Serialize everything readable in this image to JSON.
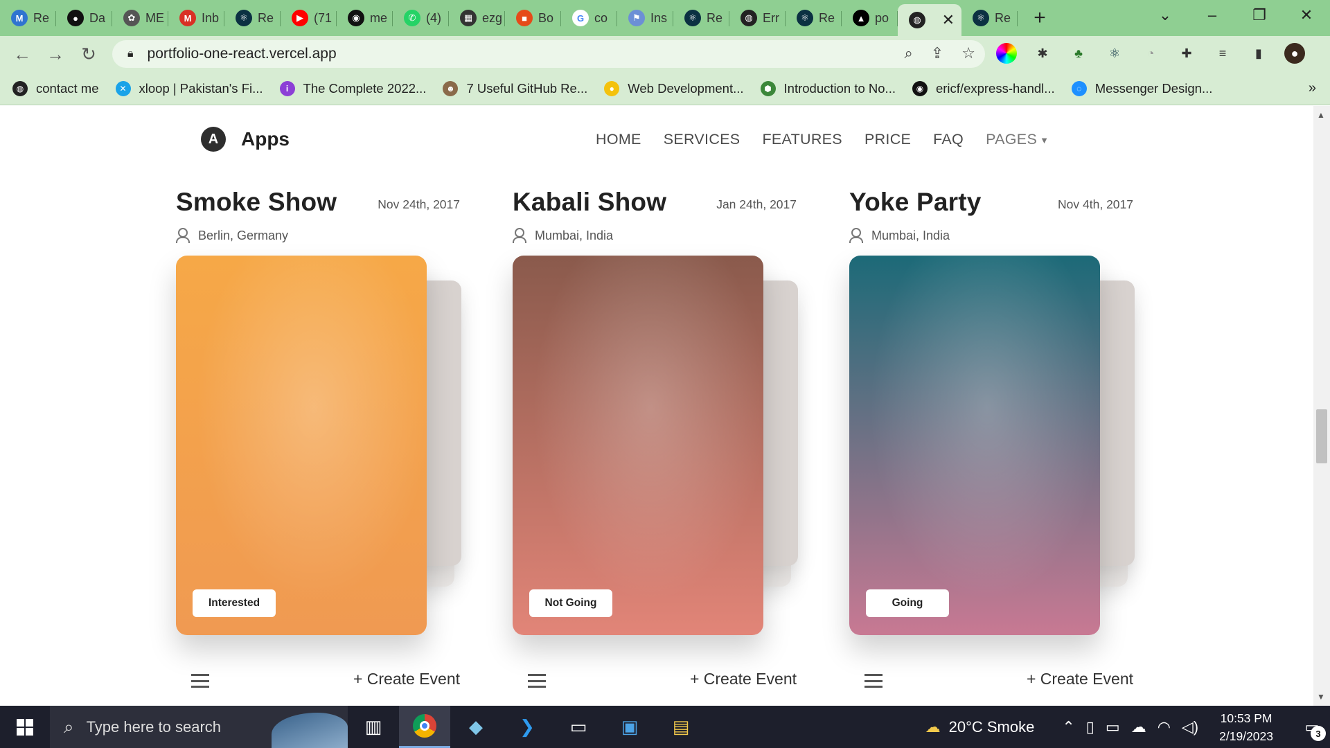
{
  "browser": {
    "tabs": [
      {
        "title": "Re",
        "icon": "maze-icon",
        "color": "#2f74d0",
        "glyph": "M"
      },
      {
        "title": "Da",
        "icon": "leaf-icon",
        "color": "#111111",
        "glyph": "●"
      },
      {
        "title": "ME",
        "icon": "openai-icon",
        "color": "#555555",
        "glyph": "✿"
      },
      {
        "title": "Inb",
        "icon": "gmail-icon",
        "color": "#d93025",
        "glyph": "M"
      },
      {
        "title": "Re",
        "icon": "react-icon",
        "color": "#0b3142",
        "glyph": "⚛"
      },
      {
        "title": "(71",
        "icon": "youtube-icon",
        "color": "#ff0000",
        "glyph": "▶"
      },
      {
        "title": "me",
        "icon": "github-icon",
        "color": "#111111",
        "glyph": "◉"
      },
      {
        "title": "(4)",
        "icon": "whatsapp-icon",
        "color": "#25d366",
        "glyph": "✆"
      },
      {
        "title": "ezg",
        "icon": "ezgif-icon",
        "color": "#333333",
        "glyph": "▦"
      },
      {
        "title": "Bo",
        "icon": "box-icon",
        "color": "#e64a19",
        "glyph": "■"
      },
      {
        "title": "co",
        "icon": "google-icon",
        "color": "#ffffff",
        "glyph": "G"
      },
      {
        "title": "Ins",
        "icon": "flag-icon",
        "color": "#6c8fd6",
        "glyph": "⚑"
      },
      {
        "title": "Re",
        "icon": "react-icon",
        "color": "#0b3142",
        "glyph": "⚛"
      },
      {
        "title": "Err",
        "icon": "globe-icon",
        "color": "#222222",
        "glyph": "◍"
      },
      {
        "title": "Re",
        "icon": "react-icon",
        "color": "#0b3142",
        "glyph": "⚛"
      },
      {
        "title": "po",
        "icon": "vercel-icon",
        "color": "#000000",
        "glyph": "▲"
      },
      {
        "title": "",
        "icon": "globe-icon",
        "color": "#222222",
        "glyph": "◍",
        "active": true
      },
      {
        "title": "Re",
        "icon": "react-icon",
        "color": "#0b3142",
        "glyph": "⚛"
      }
    ],
    "new_tab": "+",
    "url": "portfolio-one-react.vercel.app",
    "bookmarks": [
      {
        "label": "contact me",
        "icon": "globe-icon",
        "color": "#222222",
        "glyph": "◍"
      },
      {
        "label": "xloop | Pakistan's Fi...",
        "icon": "xloop-icon",
        "color": "#1aa3e8",
        "glyph": "✕"
      },
      {
        "label": "The Complete 2022...",
        "icon": "udemy-icon",
        "color": "#8c3fd6",
        "glyph": "i"
      },
      {
        "label": "7 Useful GitHub Re...",
        "icon": "dog-icon",
        "color": "#8a6a4a",
        "glyph": "☻"
      },
      {
        "label": "Web Development...",
        "icon": "web-dev-icon",
        "color": "#f4c20d",
        "glyph": "●"
      },
      {
        "label": "Introduction to No...",
        "icon": "node-icon",
        "color": "#3c873a",
        "glyph": "⬢"
      },
      {
        "label": "ericf/express-handl...",
        "icon": "github-icon",
        "color": "#111111",
        "glyph": "◉"
      },
      {
        "label": "Messenger Design...",
        "icon": "messenger-icon",
        "color": "#1e90ff",
        "glyph": "◌"
      }
    ],
    "more_bookmarks": "»"
  },
  "site": {
    "brand": "Apps",
    "logo_glyph": "A",
    "menu": [
      "HOME",
      "SERVICES",
      "FEATURES",
      "PRICE",
      "FAQ"
    ],
    "pages_menu": "PAGES",
    "events": [
      {
        "title": "Smoke Show",
        "date": "Nov 24th, 2017",
        "location": "Berlin, Germany",
        "status": "Interested",
        "create": "+ Create Event",
        "photo_top": "#f6a847",
        "photo_bottom": "#f09a52"
      },
      {
        "title": "Kabali Show",
        "date": "Jan 24th, 2017",
        "location": "Mumbai, India",
        "status": "Not Going",
        "create": "+ Create Event",
        "photo_top": "#8a5a4c",
        "photo_bottom": "#e28578"
      },
      {
        "title": "Yoke Party",
        "date": "Nov 4th, 2017",
        "location": "Mumbai, India",
        "status": "Going",
        "create": "+ Create Event",
        "photo_top": "#1c6a78",
        "photo_bottom": "#c87993"
      }
    ]
  },
  "taskbar": {
    "search_placeholder": "Type here to search",
    "weather": "20°C  Smoke",
    "time": "10:53 PM",
    "date": "2/19/2023",
    "notifications": "3"
  }
}
